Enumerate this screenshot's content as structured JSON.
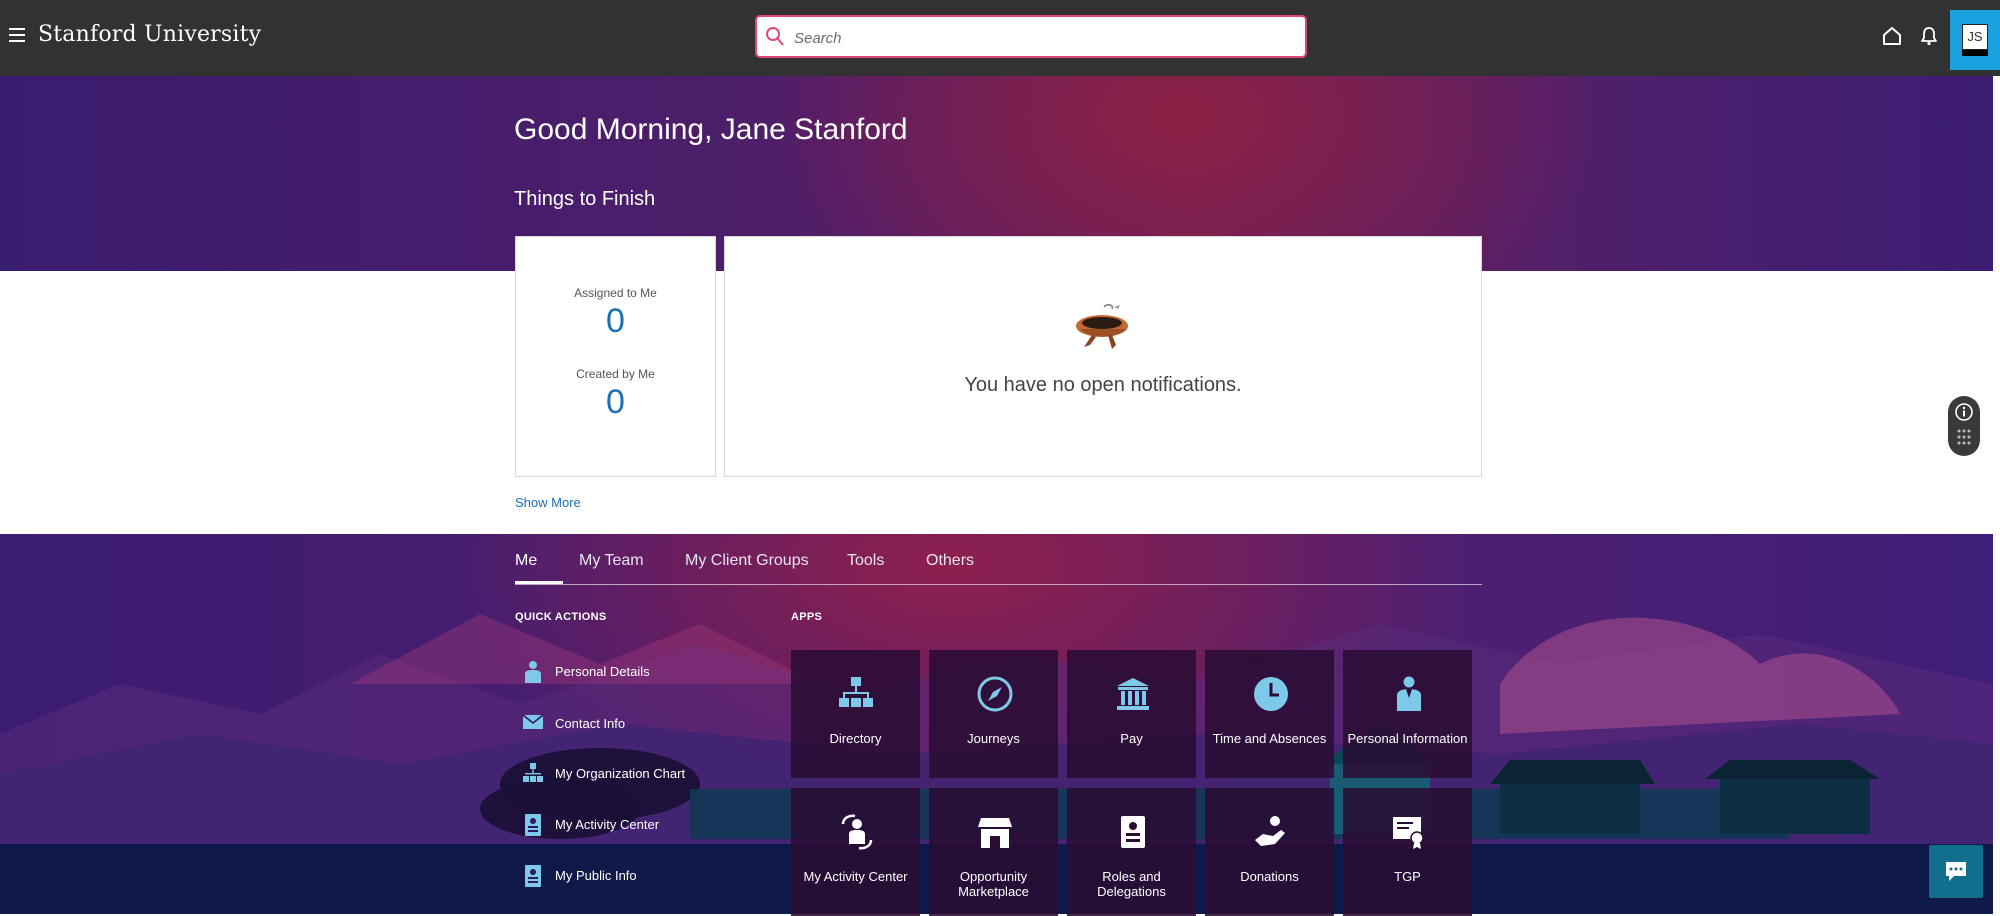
{
  "header": {
    "brand": "Stanford University",
    "search_placeholder": "Search",
    "avatar_initials": "JS"
  },
  "hero": {
    "greeting": "Good Morning, Jane Stanford",
    "section_title": "Things to Finish"
  },
  "counts": {
    "assigned_label": "Assigned to Me",
    "assigned_value": "0",
    "created_label": "Created by Me",
    "created_value": "0"
  },
  "notifications": {
    "empty_text": "You have no open notifications."
  },
  "show_more": "Show More",
  "tabs": [
    {
      "label": "Me",
      "active": true
    },
    {
      "label": "My Team"
    },
    {
      "label": "My Client Groups"
    },
    {
      "label": "Tools"
    },
    {
      "label": "Others"
    }
  ],
  "quick_actions": {
    "title": "QUICK ACTIONS",
    "items": [
      {
        "label": "Personal Details",
        "icon": "person-icon"
      },
      {
        "label": "Contact Info",
        "icon": "envelope-icon"
      },
      {
        "label": "My Organization Chart",
        "icon": "org-chart-icon"
      },
      {
        "label": "My Activity Center",
        "icon": "badge-icon"
      },
      {
        "label": "My Public Info",
        "icon": "badge-icon"
      }
    ]
  },
  "apps": {
    "title": "APPS",
    "tiles": [
      {
        "label": "Directory",
        "icon": "org-chart-icon"
      },
      {
        "label": "Journeys",
        "icon": "compass-icon"
      },
      {
        "label": "Pay",
        "icon": "bank-icon"
      },
      {
        "label": "Time and Absences",
        "icon": "clock-icon"
      },
      {
        "label": "Personal Information",
        "icon": "person-icon"
      },
      {
        "label": "My Activity Center",
        "icon": "activity-center-icon"
      },
      {
        "label": "Opportunity Marketplace",
        "icon": "storefront-icon"
      },
      {
        "label": "Roles and Delegations",
        "icon": "id-card-icon"
      },
      {
        "label": "Donations",
        "icon": "donation-icon"
      },
      {
        "label": "TGP",
        "icon": "certificate-icon"
      }
    ]
  },
  "colors": {
    "header_bg": "#323232",
    "accent_link": "#1b6fb3",
    "search_border": "#e0457b",
    "avatar_highlight": "#1aa1e0",
    "icon_blue": "#7ec8ea",
    "chat_button": "#116e8c"
  }
}
